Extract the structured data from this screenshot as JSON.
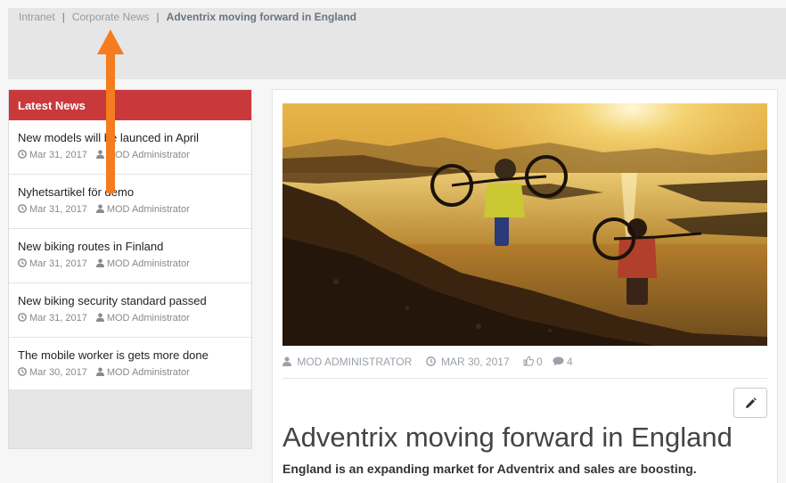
{
  "breadcrumb": {
    "items": [
      {
        "label": "Intranet"
      },
      {
        "label": "Corporate News"
      }
    ],
    "separator": "|",
    "current": "Adventrix moving forward in England"
  },
  "sidebar": {
    "title": "Latest News",
    "items": [
      {
        "title": "New models will be launced in April",
        "date": "Mar 31, 2017",
        "author": "MOD Administrator"
      },
      {
        "title": "Nyhetsartikel för demo",
        "date": "Mar 31, 2017",
        "author": "MOD Administrator"
      },
      {
        "title": "New biking routes in Finland",
        "date": "Mar 31, 2017",
        "author": "MOD Administrator"
      },
      {
        "title": "New biking security standard passed",
        "date": "Mar 31, 2017",
        "author": "MOD Administrator"
      },
      {
        "title": "The mobile worker is gets more done",
        "date": "Mar 30, 2017",
        "author": "MOD Administrator"
      }
    ]
  },
  "article": {
    "author": "MOD ADMINISTRATOR",
    "date": "MAR 30, 2017",
    "likes": "0",
    "comments": "4",
    "title": "Adventrix moving forward in England",
    "lead": "England is an expanding market for Adventrix and sales are boosting.",
    "edit_icon": "pencil-icon"
  },
  "colors": {
    "accent_red": "#c9393c",
    "annotation_orange": "#f57c1f",
    "meta_gray": "#9aa1a9"
  }
}
